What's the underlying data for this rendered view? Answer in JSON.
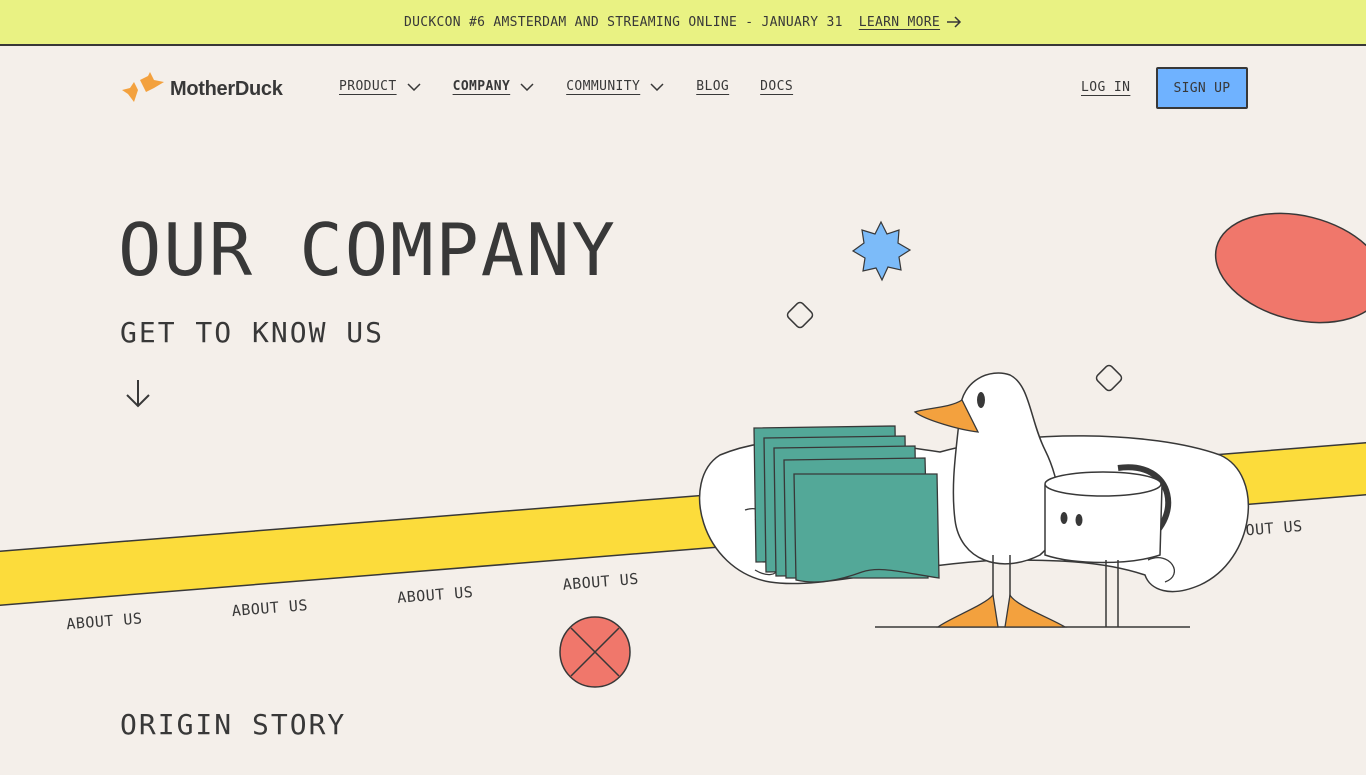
{
  "announcement": {
    "text": "DUCKCON #6 AMSTERDAM AND STREAMING ONLINE - JANUARY 31",
    "link_label": "LEARN MORE"
  },
  "brand": {
    "name": "MotherDuck"
  },
  "nav": {
    "items": [
      {
        "label": "PRODUCT",
        "dropdown": true,
        "active": false
      },
      {
        "label": "COMPANY",
        "dropdown": true,
        "active": true
      },
      {
        "label": "COMMUNITY",
        "dropdown": true,
        "active": false
      },
      {
        "label": "BLOG",
        "dropdown": false,
        "active": false
      },
      {
        "label": "DOCS",
        "dropdown": false,
        "active": false
      }
    ],
    "login_label": "LOG IN",
    "signup_label": "SIGN UP"
  },
  "hero": {
    "title": "OUR COMPANY",
    "subtitle": "GET TO KNOW US",
    "ribbon_label": "ABOUT US"
  },
  "sections": {
    "origin_title": "ORIGIN STORY"
  },
  "colors": {
    "background": "#f4efea",
    "announcement_bg": "#e9f283",
    "signup_bg": "#6fb2ff",
    "ribbon_yellow": "#fcdc3b",
    "coral": "#f0776b",
    "teal": "#53a898",
    "duck_orange": "#f3a13e",
    "star_blue": "#7cbbf9",
    "ink": "#383838"
  },
  "icons": {
    "learn_more": "arrow-right-icon",
    "dropdown": "chevron-down-icon",
    "scroll": "arrow-down-icon"
  }
}
